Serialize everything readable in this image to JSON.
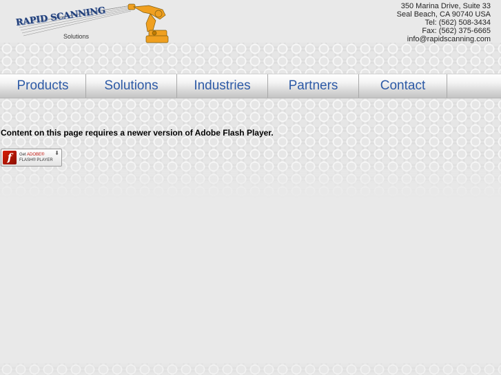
{
  "logo": {
    "title": "RAPID SCANNING",
    "subtitle": "Solutions"
  },
  "address": {
    "line1": "350 Marina Drive, Suite 33",
    "line2": "Seal Beach, CA 90740 USA",
    "tel": "Tel:  (562) 508-3434",
    "fax": "Fax: (562) 375-6665",
    "email": "info@rapidscanning.com"
  },
  "nav": {
    "items": [
      {
        "label": "Products"
      },
      {
        "label": "Solutions"
      },
      {
        "label": "Industries"
      },
      {
        "label": "Partners"
      },
      {
        "label": "Contact"
      }
    ]
  },
  "flash": {
    "message": "Content on this page requires a newer version of Adobe Flash Player.",
    "badge_get": "Get",
    "badge_adobe": "ADOBE®",
    "badge_product": "FLASH® PLAYER"
  },
  "colors": {
    "nav_text": "#2d5aa6",
    "logo_blue": "#1f3e7a",
    "robot_orange": "#f0a020"
  }
}
